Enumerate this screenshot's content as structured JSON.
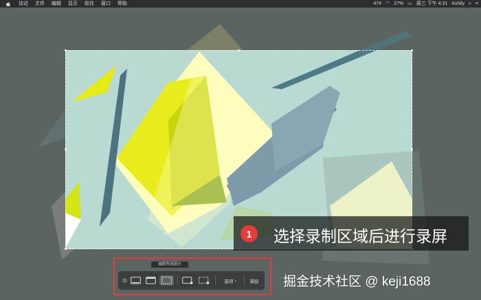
{
  "menubar": {
    "items": [
      "访达",
      "文件",
      "编辑",
      "显示",
      "前往",
      "窗口",
      "帮助"
    ],
    "status": {
      "network": "474",
      "battery": "27%",
      "datetime": "周三 下午 4:31",
      "user": "Ashily"
    }
  },
  "callout": {
    "step_number": "1",
    "text": "选择录制区域后进行录屏"
  },
  "toolbar": {
    "tooltip": "捕捉所选部分",
    "options_label": "选项",
    "capture_label": "捕捉"
  },
  "watermark": "掘金技术社区 @ keji1688",
  "colors": {
    "highlight": "#e13b3b",
    "badge": "#e63b3b"
  },
  "icons": [
    "apple-icon",
    "close-icon",
    "capture-window-icon",
    "capture-screen-icon",
    "capture-selection-icon",
    "record-screen-icon",
    "record-selection-icon"
  ]
}
